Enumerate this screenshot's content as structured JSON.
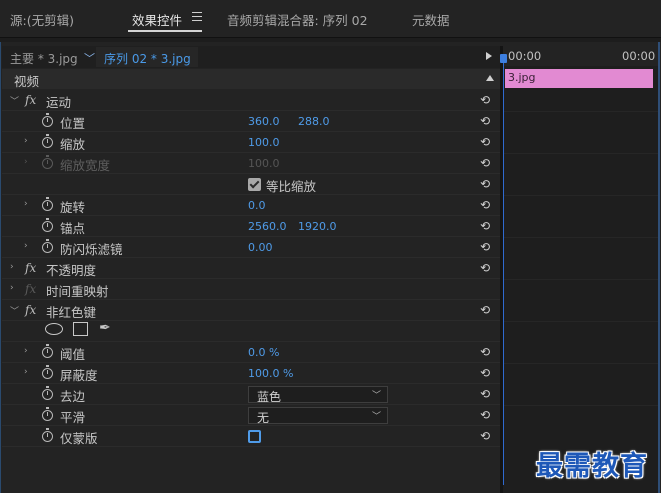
{
  "tabs": [
    {
      "label": "源:(无剪辑)"
    },
    {
      "label": "效果控件"
    },
    {
      "label": "音频剪辑混合器: 序列 02"
    },
    {
      "label": "元数据"
    }
  ],
  "clip_header": {
    "master": "主要 * 3.jpg",
    "sequence": "序列 02 * 3.jpg"
  },
  "section": {
    "label": "视频"
  },
  "effects": {
    "motion": {
      "label": "运动",
      "position": {
        "label": "位置",
        "x": "360.0",
        "y": "288.0"
      },
      "scale": {
        "label": "缩放",
        "value": "100.0"
      },
      "scale_width": {
        "label": "缩放宽度",
        "value": "100.0"
      },
      "uniform_scale": {
        "label": "等比缩放",
        "checked": true
      },
      "rotation": {
        "label": "旋转",
        "value": "0.0"
      },
      "anchor": {
        "label": "锚点",
        "x": "2560.0",
        "y": "1920.0"
      },
      "anti_flicker": {
        "label": "防闪烁滤镜",
        "value": "0.00"
      }
    },
    "opacity": {
      "label": "不透明度"
    },
    "time_remap": {
      "label": "时间重映射"
    },
    "non_red_key": {
      "label": "非红色键",
      "threshold": {
        "label": "阈值",
        "value": "0.0 %"
      },
      "cutoff": {
        "label": "屏蔽度",
        "value": "100.0 %"
      },
      "defringe": {
        "label": "去边",
        "value": "蓝色"
      },
      "smoothing": {
        "label": "平滑",
        "value": "无"
      },
      "mask_only": {
        "label": "仅蒙版",
        "checked": false
      }
    }
  },
  "timeline": {
    "tc_start": "00:00",
    "tc_end": "00:00",
    "clip_name": "3.jpg",
    "clip_color": "#e28ad2"
  },
  "watermark": "最需教育"
}
